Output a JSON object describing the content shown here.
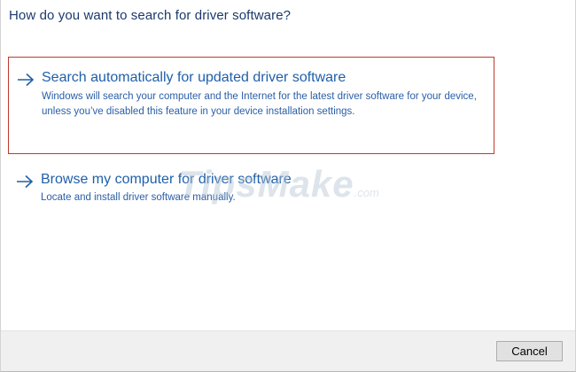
{
  "dialog": {
    "heading": "How do you want to search for driver software?"
  },
  "options": [
    {
      "title": "Search automatically for updated driver software",
      "description": "Windows will search your computer and the Internet for the latest driver software for your device, unless you’ve disabled this feature in your device installation settings.",
      "selected": true
    },
    {
      "title": "Browse my computer for driver software",
      "description": "Locate and install driver software manually.",
      "selected": false
    }
  ],
  "watermark": {
    "brand": "TipsMake",
    "suffix": ".com"
  },
  "footer": {
    "cancel_label": "Cancel"
  },
  "colors": {
    "heading": "#1b3a6b",
    "link": "#1f5fa9",
    "selection_border": "#c0392b",
    "footer_bg": "#f0f0f0"
  },
  "icons": {
    "option_arrow": "arrow-right-icon"
  }
}
